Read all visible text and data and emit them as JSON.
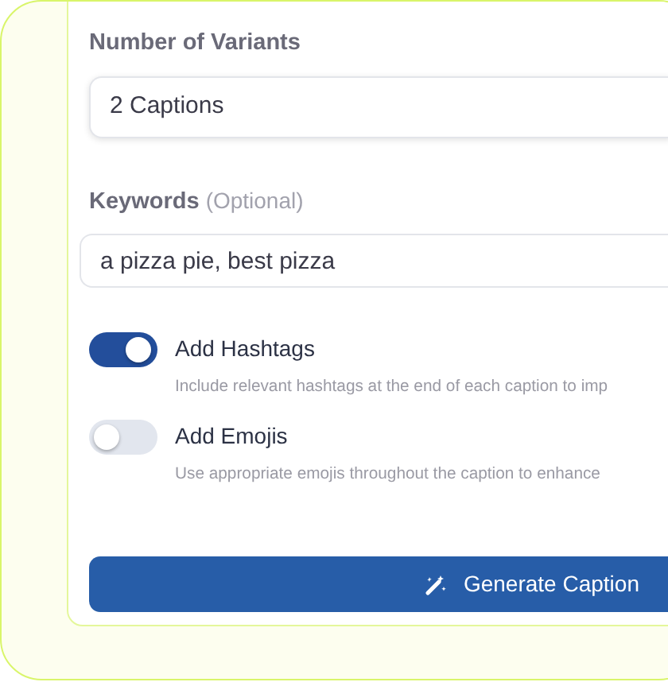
{
  "variants": {
    "label": "Number of Variants",
    "value": "2 Captions"
  },
  "keywords": {
    "label": "Keywords",
    "hint": "(Optional)",
    "value": "a pizza pie, best pizza"
  },
  "options": [
    {
      "label": "Add Hashtags",
      "description": "Include relevant hashtags at the end of each caption to imp",
      "on": true
    },
    {
      "label": "Add Emojis",
      "description": "Use appropriate emojis throughout the caption to enhance",
      "on": false
    }
  ],
  "generate_button": {
    "label": "Generate Caption"
  }
}
